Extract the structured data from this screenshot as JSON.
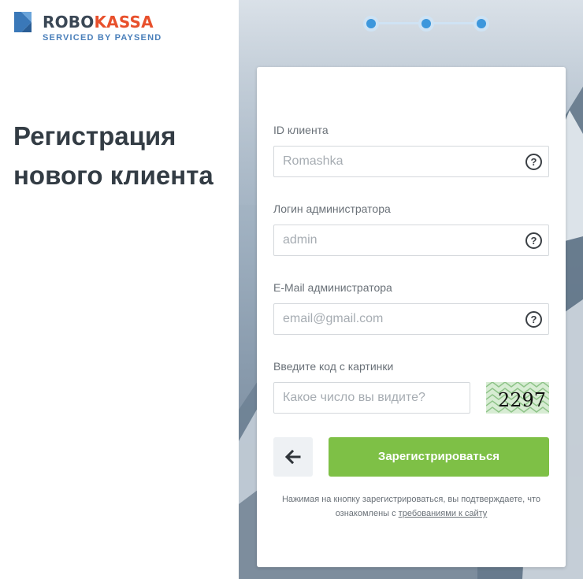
{
  "brand": {
    "name_part1": "ROBO",
    "name_part2": "KASSA",
    "tagline": "SERVICED BY PAYSEND",
    "primary_color": "#3a4755",
    "accent_color": "#e8502c",
    "tagline_color": "#4a7fba"
  },
  "page": {
    "title": "Регистрация нового клиента"
  },
  "stepper": {
    "total_steps": 3,
    "color": "#3d97dc"
  },
  "form": {
    "client_id": {
      "label": "ID клиента",
      "placeholder": "Romashka",
      "help_icon": "question-circle-icon"
    },
    "admin_login": {
      "label": "Логин администратора",
      "placeholder": "admin",
      "help_icon": "question-circle-icon"
    },
    "admin_email": {
      "label": "E-Mail администратора",
      "placeholder": "email@gmail.com",
      "help_icon": "question-circle-icon"
    },
    "captcha": {
      "label": "Введите код с картинки",
      "placeholder": "Какое число вы видите?",
      "image_text": "2297"
    },
    "back_button_icon": "arrow-left-icon",
    "submit_label": "Зарегистрироваться",
    "submit_color": "#7ec046",
    "terms_text": "Нажимая на кнопку зарегистрироваться, вы подтверждаете, что ознакомлены с",
    "terms_link": "требованиями к сайту"
  }
}
